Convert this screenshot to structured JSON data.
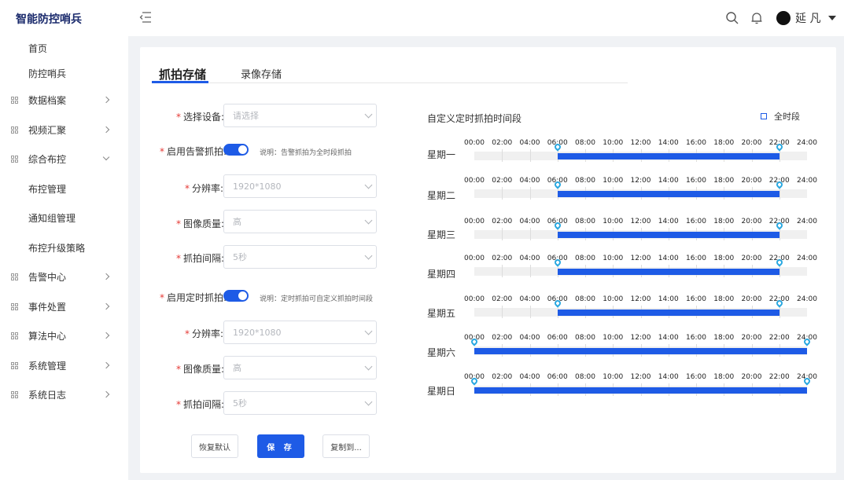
{
  "app": {
    "title": "智能防控哨兵"
  },
  "header": {
    "user_name": "延 凡"
  },
  "sidebar": {
    "items": [
      {
        "label": "首页",
        "icon": false,
        "arrow": "none"
      },
      {
        "label": "防控哨兵",
        "icon": false,
        "arrow": "none"
      },
      {
        "label": "数据档案",
        "icon": true,
        "arrow": "right"
      },
      {
        "label": "视频汇聚",
        "icon": true,
        "arrow": "right"
      },
      {
        "label": "综合布控",
        "icon": true,
        "arrow": "down"
      },
      {
        "label": "布控管理",
        "icon": false,
        "arrow": "none"
      },
      {
        "label": "通知组管理",
        "icon": false,
        "arrow": "none"
      },
      {
        "label": "布控升级策略",
        "icon": false,
        "arrow": "none"
      },
      {
        "label": "告警中心",
        "icon": true,
        "arrow": "right"
      },
      {
        "label": "事件处置",
        "icon": true,
        "arrow": "right"
      },
      {
        "label": "算法中心",
        "icon": true,
        "arrow": "right"
      },
      {
        "label": "系统管理",
        "icon": true,
        "arrow": "right"
      },
      {
        "label": "系统日志",
        "icon": true,
        "arrow": "right"
      }
    ]
  },
  "tabs": [
    {
      "label": "抓拍存储",
      "active": true
    },
    {
      "label": "录像存储",
      "active": false
    }
  ],
  "form": {
    "device_label": "选择设备:",
    "device_placeholder": "请选择",
    "alarm_label": "启用告警抓拍:",
    "alarm_note": "说明：告警抓拍为全时段抓拍",
    "res1_label": "分辨率:",
    "res1_value": "1920*1080",
    "quality1_label": "图像质量:",
    "quality1_value": "高",
    "interval1_label": "抓拍间隔:",
    "interval1_value": "5秒",
    "timed_label": "启用定时抓拍:",
    "timed_note": "说明：定时抓拍可自定义抓拍时间段",
    "res2_label": "分辨率:",
    "res2_value": "1920*1080",
    "quality2_label": "图像质量:",
    "quality2_value": "高",
    "interval2_label": "抓拍间隔:",
    "interval2_value": "5秒"
  },
  "buttons": {
    "reset": "恢复默认",
    "save": "保 存",
    "copy": "复制到..."
  },
  "schedule": {
    "title": "自定义定时抓拍时间段",
    "allday_label": "全时段",
    "ticks": [
      "00:00",
      "02:00",
      "04:00",
      "06:00",
      "08:00",
      "10:00",
      "12:00",
      "14:00",
      "16:00",
      "18:00",
      "20:00",
      "22:00",
      "24:00"
    ],
    "days": [
      {
        "label": "星期一",
        "start": 6,
        "end": 22
      },
      {
        "label": "星期二",
        "start": 6,
        "end": 22
      },
      {
        "label": "星期三",
        "start": 6,
        "end": 22
      },
      {
        "label": "星期四",
        "start": 6,
        "end": 22
      },
      {
        "label": "星期五",
        "start": 6,
        "end": 22
      },
      {
        "label": "星期六",
        "start": 0,
        "end": 24
      },
      {
        "label": "星期日",
        "start": 0,
        "end": 24
      }
    ]
  },
  "colors": {
    "primary": "#1e5be6",
    "pin": "#29a8e0",
    "required": "#e53935"
  }
}
